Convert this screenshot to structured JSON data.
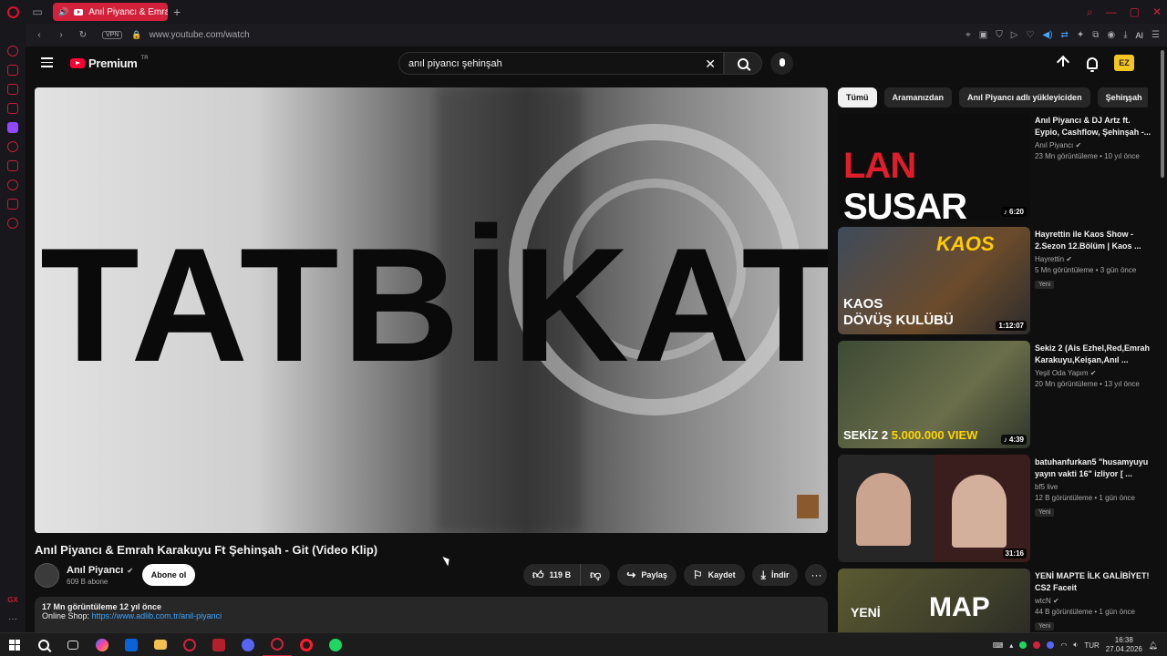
{
  "browser": {
    "tab_title": "Anıl Piyancı & Emrah K",
    "url": "www.youtube.com/watch",
    "vpn_label": "VPN",
    "ai_label": "AI"
  },
  "youtube": {
    "logo_text": "Premium",
    "logo_region": "TR",
    "search_value": "anıl piyancı şehinşah",
    "avatar_text": "EZ"
  },
  "video": {
    "overlay_text": "TATBİKAT",
    "title": "Anıl Piyancı & Emrah Karakuyu Ft Şehinşah - Git (Video Klip)",
    "channel_name": "Anıl Piyancı",
    "subscribers": "609 B abone",
    "subscribe_label": "Abone ol",
    "likes": "119 B",
    "share_label": "Paylaş",
    "save_label": "Kaydet",
    "download_label": "İndir",
    "stats": "17 Mn görüntüleme  12 yıl önce",
    "shop_label": "Online Shop:",
    "shop_link": "https://www.adlib.com.tr/anil-piyanci"
  },
  "chips": [
    "Tümü",
    "Aramanızdan",
    "Anıl Piyancı adlı yükleyiciden",
    "Şehinşah"
  ],
  "recommendations": [
    {
      "title": "Anıl Piyancı & DJ Artz ft. Eypio, Cashflow, Şehinşah -...",
      "channel": "Anıl Piyancı",
      "views": "23 Mn görüntüleme • 10 yıl önce",
      "duration": "♪ 6:20",
      "badge": "",
      "thumb_text_a": "LAN ",
      "thumb_text_b": "SUSAR MI?"
    },
    {
      "title": "Hayrettin ile Kaos Show - 2.Sezon 12.Bölüm | Kaos ...",
      "channel": "Hayrettin",
      "views": "5 Mn görüntüleme • 3 gün önce",
      "duration": "1:12:07",
      "badge": "Yeni",
      "thumb_text_a": "KAOS",
      "thumb_text_b": "DÖVÜŞ KULÜBÜ",
      "thumb_logo": "KAOS"
    },
    {
      "title": "Sekiz 2 (Ais Ezhel,Red,Emrah Karakuyu,Keişan,Anıl ...",
      "channel": "Yeşil Oda Yapım",
      "views": "20 Mn görüntüleme • 13 yıl önce",
      "duration": "♪ 4:39",
      "badge": "",
      "thumb_text_a": "SEKİZ 2 ",
      "thumb_text_b": "5.000.000 VIEW"
    },
    {
      "title": "batuhanfurkan5 \"husamyuyu yayın vakti 16\" izliyor [ ...",
      "channel": "bf5 live",
      "views": "12 B görüntüleme • 1 gün önce",
      "duration": "31:16",
      "badge": "Yeni"
    },
    {
      "title": "YENİ MAPTE İLK GALİBİYET! CS2 Faceit",
      "channel": "wtcN",
      "views": "44 B görüntüleme • 1 gün önce",
      "duration": "",
      "badge": "Yeni",
      "thumb_text_a": "YENİ",
      "thumb_text_b": "MAP"
    }
  ],
  "taskbar": {
    "lang": "TUR",
    "time": "16:38",
    "date": "27.04.2026"
  },
  "colors": {
    "accent": "#d3213c",
    "youtube_red": "#ff0033",
    "link": "#3ea6ff"
  }
}
